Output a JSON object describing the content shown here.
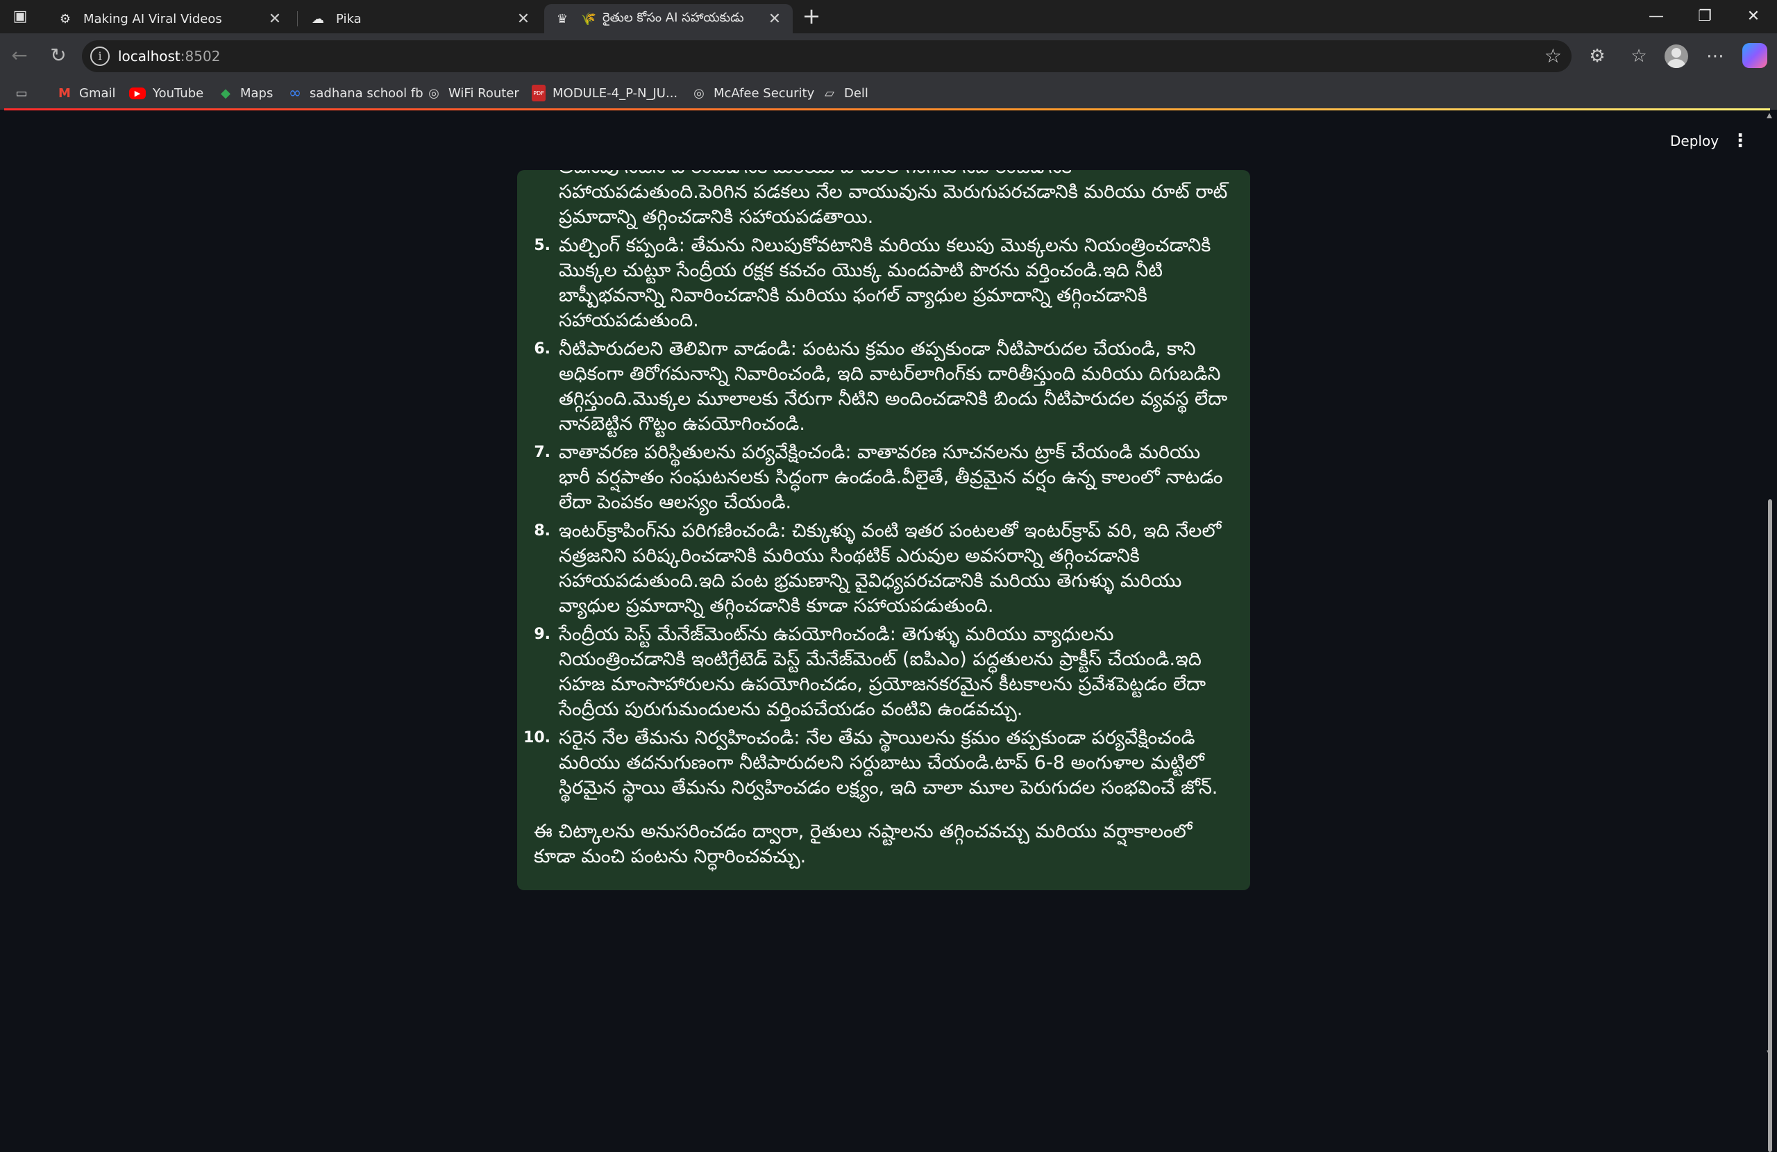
{
  "browser": {
    "tabs": [
      {
        "title": "Making AI Viral Videos",
        "icon": "gear-icon",
        "close": "✕"
      },
      {
        "title": "Pika",
        "icon": "cloud-icon",
        "close": "✕"
      },
      {
        "title": "రైతుల కోసం AI సహాయకుడు",
        "icon": "crown-icon",
        "extra_icon": "🌾",
        "close": "✕"
      }
    ],
    "new_tab": "+",
    "address": {
      "host": "localhost",
      "port": ":8502"
    },
    "bookmarks": [
      {
        "label": "Gmail",
        "icon": "gmail-icon"
      },
      {
        "label": "YouTube",
        "icon": "youtube-icon"
      },
      {
        "label": "Maps",
        "icon": "maps-icon"
      },
      {
        "label": "sadhana school fb",
        "icon": "meta-icon"
      },
      {
        "label": "WiFi Router",
        "icon": "globe-icon"
      },
      {
        "label": "MODULE-4_P-N_JU...",
        "icon": "pdf-icon"
      },
      {
        "label": "McAfee Security",
        "icon": "globe-icon"
      },
      {
        "label": "Dell",
        "icon": "folder-icon"
      }
    ],
    "window_controls": {
      "minimize": "—",
      "restore": "❐",
      "close": "✕"
    }
  },
  "app": {
    "deploy_label": "Deploy",
    "menu_glyph": "⋮",
    "response": {
      "cut_top_line": "అదనపు నీటిని హరించడానికి మరియు వాటర్‌లాగింగ్‌ను నివారించడానికి",
      "item4_tail": "సహాయపడుతుంది.పెరిగిన పడకలు నేల వాయువును మెరుగుపరచడానికి మరియు రూట్ రాట్ ప్రమాదాన్ని తగ్గించడానికి సహాయపడతాయి.",
      "items": [
        {
          "num": "5.",
          "text": "మల్చింగ్ కప్పండి: తేమను నిలుపుకోవటానికి మరియు కలుపు మొక్కలను నియంత్రించడానికి మొక్కల చుట్టూ సేంద్రీయ రక్షక కవచం యొక్క మందపాటి పొరను వర్తించండి.ఇది నీటి బాష్పీభవనాన్ని నివారించడానికి మరియు ఫంగల్ వ్యాధుల ప్రమాదాన్ని తగ్గించడానికి సహాయపడుతుంది."
        },
        {
          "num": "6.",
          "text": "నీటిపారుదలని తెలివిగా వాడండి: పంటను క్రమం తప్పకుండా నీటిపారుదల చేయండి, కాని అధికంగా తిరోగమనాన్ని నివారించండి, ఇది వాటర్‌లాగింగ్‌కు దారితీస్తుంది మరియు దిగుబడిని తగ్గిస్తుంది.మొక్కల మూలాలకు నేరుగా నీటిని అందించడానికి బిందు నీటిపారుదల వ్యవస్థ లేదా నానబెట్టిన గొట్టం ఉపయోగించండి."
        },
        {
          "num": "7.",
          "text": "వాతావరణ పరిస్థితులను పర్యవేక్షించండి: వాతావరణ సూచనలను ట్రాక్ చేయండి మరియు భారీ వర్షపాతం సంఘటనలకు సిద్ధంగా ఉండండి.వీలైతే, తీవ్రమైన వర్షం ఉన్న కాలంలో నాటడం లేదా పెంపకం ఆలస్యం చేయండి."
        },
        {
          "num": "8.",
          "text": "ఇంటర్‌క్రాపింగ్‌ను పరిగణించండి: చిక్కుళ్ళు వంటి ఇతర పంటలతో ఇంటర్‌క్రాప్ వరి, ఇది నేలలో నత్రజనిని పరిష్కరించడానికి మరియు సింథటిక్ ఎరువుల అవసరాన్ని తగ్గించడానికి సహాయపడుతుంది.ఇది పంట భ్రమణాన్ని వైవిధ్యపరచడానికి మరియు తెగుళ్ళు మరియు వ్యాధుల ప్రమాదాన్ని తగ్గించడానికి కూడా సహాయపడుతుంది."
        },
        {
          "num": "9.",
          "text": "సేంద్రీయ పెస్ట్ మేనేజ్‌మెంట్‌ను ఉపయోగించండి: తెగుళ్ళు మరియు వ్యాధులను నియంత్రించడానికి ఇంటిగ్రేటెడ్ పెస్ట్ మేనేజ్‌మెంట్ (ఐపిఎం) పద్ధతులను ప్రాక్టీస్ చేయండి.ఇది సహజ మాంసాహారులను ఉపయోగించడం, ప్రయోజనకరమైన కీటకాలను ప్రవేశపెట్టడం లేదా సేంద్రీయ పురుగుమందులను వర్తింపచేయడం వంటివి ఉండవచ్చు."
        },
        {
          "num": "10.",
          "text": "సరైన నేల తేమను నిర్వహించండి: నేల తేమ స్థాయిలను క్రమం తప్పకుండా పర్యవేక్షించండి మరియు తదనుగుణంగా నీటిపారుదలని సర్దుబాటు చేయండి.టాప్ 6-8 అంగుళాల మట్టిలో స్థిరమైన స్థాయి తేమను నిర్వహించడం లక్ష్యం, ఇది చాలా మూల పెరుగుదల సంభవించే జోన్."
        }
      ],
      "conclusion": "ఈ చిట్కాలను అనుసరించడం ద్వారా, రైతులు నష్టాలను తగ్గించవచ్చు మరియు వర్షాకాలంలో కూడా మంచి పంటను నిర్ధారించవచ్చు."
    }
  },
  "colors": {
    "app_bg": "#0e1117",
    "card_bg": "#1f3a26",
    "text": "#fafafa",
    "accent_line": "#ff2b2b"
  }
}
